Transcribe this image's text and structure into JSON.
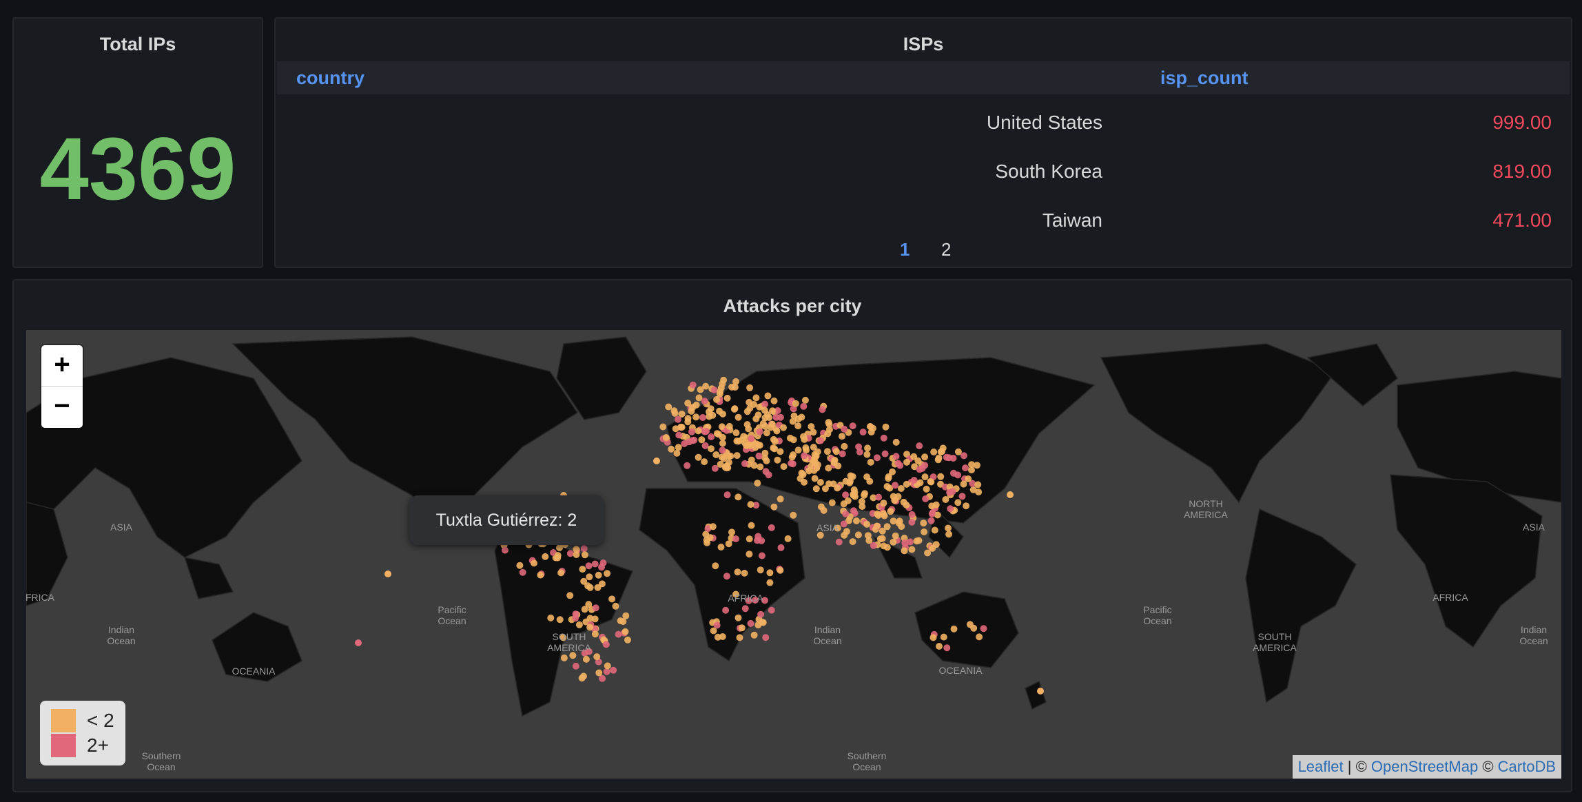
{
  "total_panel": {
    "title": "Total IPs",
    "value": "4369",
    "value_color": "#73bf69"
  },
  "isp_panel": {
    "title": "ISPs",
    "columns": [
      "country",
      "isp_count"
    ],
    "rows": [
      {
        "country": "United States",
        "isp_count": "999.00"
      },
      {
        "country": "South Korea",
        "isp_count": "819.00"
      },
      {
        "country": "Taiwan",
        "isp_count": "471.00"
      }
    ],
    "pages": [
      "1",
      "2"
    ],
    "active_page": "1"
  },
  "map_panel": {
    "title": "Attacks per city",
    "zoom_in": "+",
    "zoom_out": "−",
    "tooltip": "Tuxtla Gutiérrez: 2",
    "legend": [
      {
        "label": "< 2",
        "color": "#f2b162"
      },
      {
        "label": "2+",
        "color": "#e0687a"
      }
    ],
    "map_labels": {
      "asia_left": "ASIA",
      "africa_left": "FRICA",
      "indian_ocean_left": "Indian\nOcean",
      "oceania_left": "OCEANIA",
      "southern_ocean_left": "Southern\nOcean",
      "pacific_ocean_mid": "Pacific\nOcean",
      "south_america": "SOUTH\nAMERICA",
      "africa_mid": "AFRICA",
      "asia_mid": "ASIA",
      "indian_ocean_mid": "Indian\nOcean",
      "oceania_mid": "OCEANIA",
      "southern_ocean_mid": "Southern\nOcean",
      "north_america_right": "NORTH\nAMERICA",
      "pacific_ocean_right": "Pacific\nOcean",
      "south_america_right": "SOUTH\nAMERICA",
      "africa_right": "AFRICA",
      "asia_right": "ASIA",
      "indian_ocean_right": "Indian\nOcean"
    },
    "attribution": {
      "leaflet": "Leaflet",
      "sep1": " | © ",
      "osm": "OpenStreetMap",
      "sep2": " © ",
      "carto": "CartoDB"
    },
    "colors": {
      "low": "#f2b162",
      "high": "#e0687a",
      "land": "#0e0e0e",
      "water": "#3d3d3d"
    }
  }
}
